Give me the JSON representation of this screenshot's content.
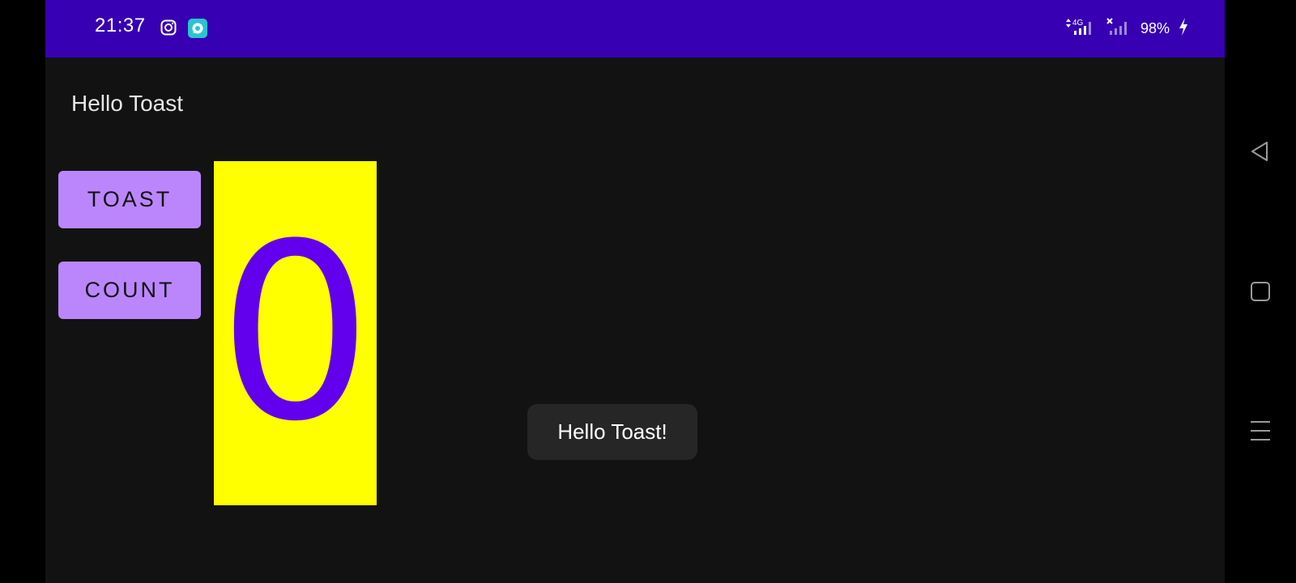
{
  "status_bar": {
    "time": "21:37",
    "network_label": "4G",
    "battery": "98%",
    "icons": [
      "instagram-icon",
      "chat-app-icon",
      "signal-4g-icon",
      "signal-no-sim-icon",
      "charging-icon"
    ]
  },
  "app": {
    "title": "Hello Toast",
    "toast_button_label": "Toast",
    "count_button_label": "Count",
    "count_value": "0"
  },
  "toast": {
    "message": "Hello Toast!"
  },
  "colors": {
    "status_bar": "#3700B3",
    "background": "#121212",
    "button": "#BB86FC",
    "count_background": "#FFFF00",
    "count_text": "#6200EE",
    "toast_background": "#262626"
  },
  "navigation": {
    "icons": [
      "back-icon",
      "home-icon",
      "recents-icon"
    ]
  }
}
